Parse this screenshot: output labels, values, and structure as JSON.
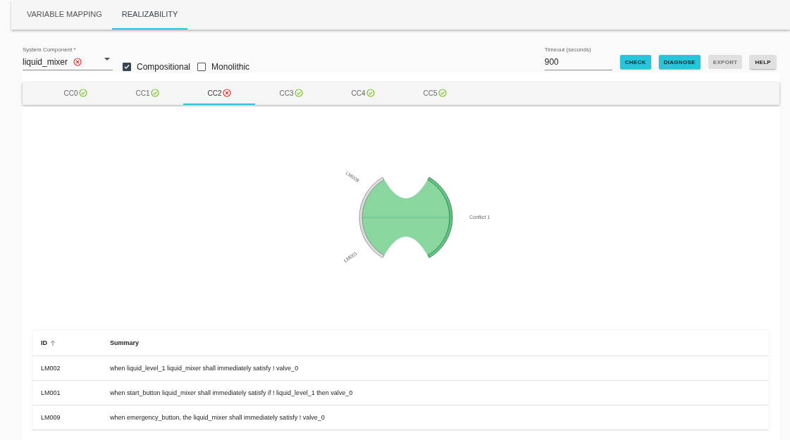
{
  "tabs": [
    {
      "label": "VARIABLE MAPPING",
      "selected": false
    },
    {
      "label": "REALIZABILITY",
      "selected": true
    }
  ],
  "system_component": {
    "label": "System Component *",
    "value": "liquid_mixer",
    "error": true
  },
  "options": [
    {
      "label": "Compositional",
      "checked": true
    },
    {
      "label": "Monolithic",
      "checked": false
    }
  ],
  "timeout": {
    "label": "Timeout (seconds)",
    "value": "900"
  },
  "buttons": [
    {
      "label": "CHECK",
      "kind": "primary",
      "disabled": false
    },
    {
      "label": "DIAGNOSE",
      "kind": "primary",
      "disabled": false
    },
    {
      "label": "EXPORT",
      "kind": "plain",
      "disabled": true
    },
    {
      "label": "HELP",
      "kind": "plain",
      "disabled": false
    }
  ],
  "components": [
    {
      "label": "CC0",
      "error": false,
      "selected": false
    },
    {
      "label": "CC1",
      "error": false,
      "selected": false
    },
    {
      "label": "CC2",
      "error": true,
      "selected": true
    },
    {
      "label": "CC3",
      "error": false,
      "selected": false
    },
    {
      "label": "CC4",
      "error": false,
      "selected": false
    },
    {
      "label": "CC5",
      "error": false,
      "selected": false
    }
  ],
  "diagram": {
    "labels": [
      {
        "text": "LM009",
        "kind": "upper"
      },
      {
        "text": "LM001",
        "kind": "lower"
      },
      {
        "text": "Conflict 1",
        "kind": "right"
      }
    ]
  },
  "table": {
    "columns": [
      {
        "label": "ID",
        "sorted": true
      },
      {
        "label": "Summary",
        "sorted": false
      }
    ],
    "rows": [
      [
        "LM002",
        "when liquid_level_1 liquid_mixer shall immediately satisfy ! valve_0"
      ],
      [
        "LM001",
        "when start_button liquid_mixer shall immediately satisfy if ! liquid_level_1 then valve_0"
      ],
      [
        "LM009",
        "when emergency_button, the liquid_mixer shall immediately satisfy ! valve_0"
      ]
    ]
  }
}
